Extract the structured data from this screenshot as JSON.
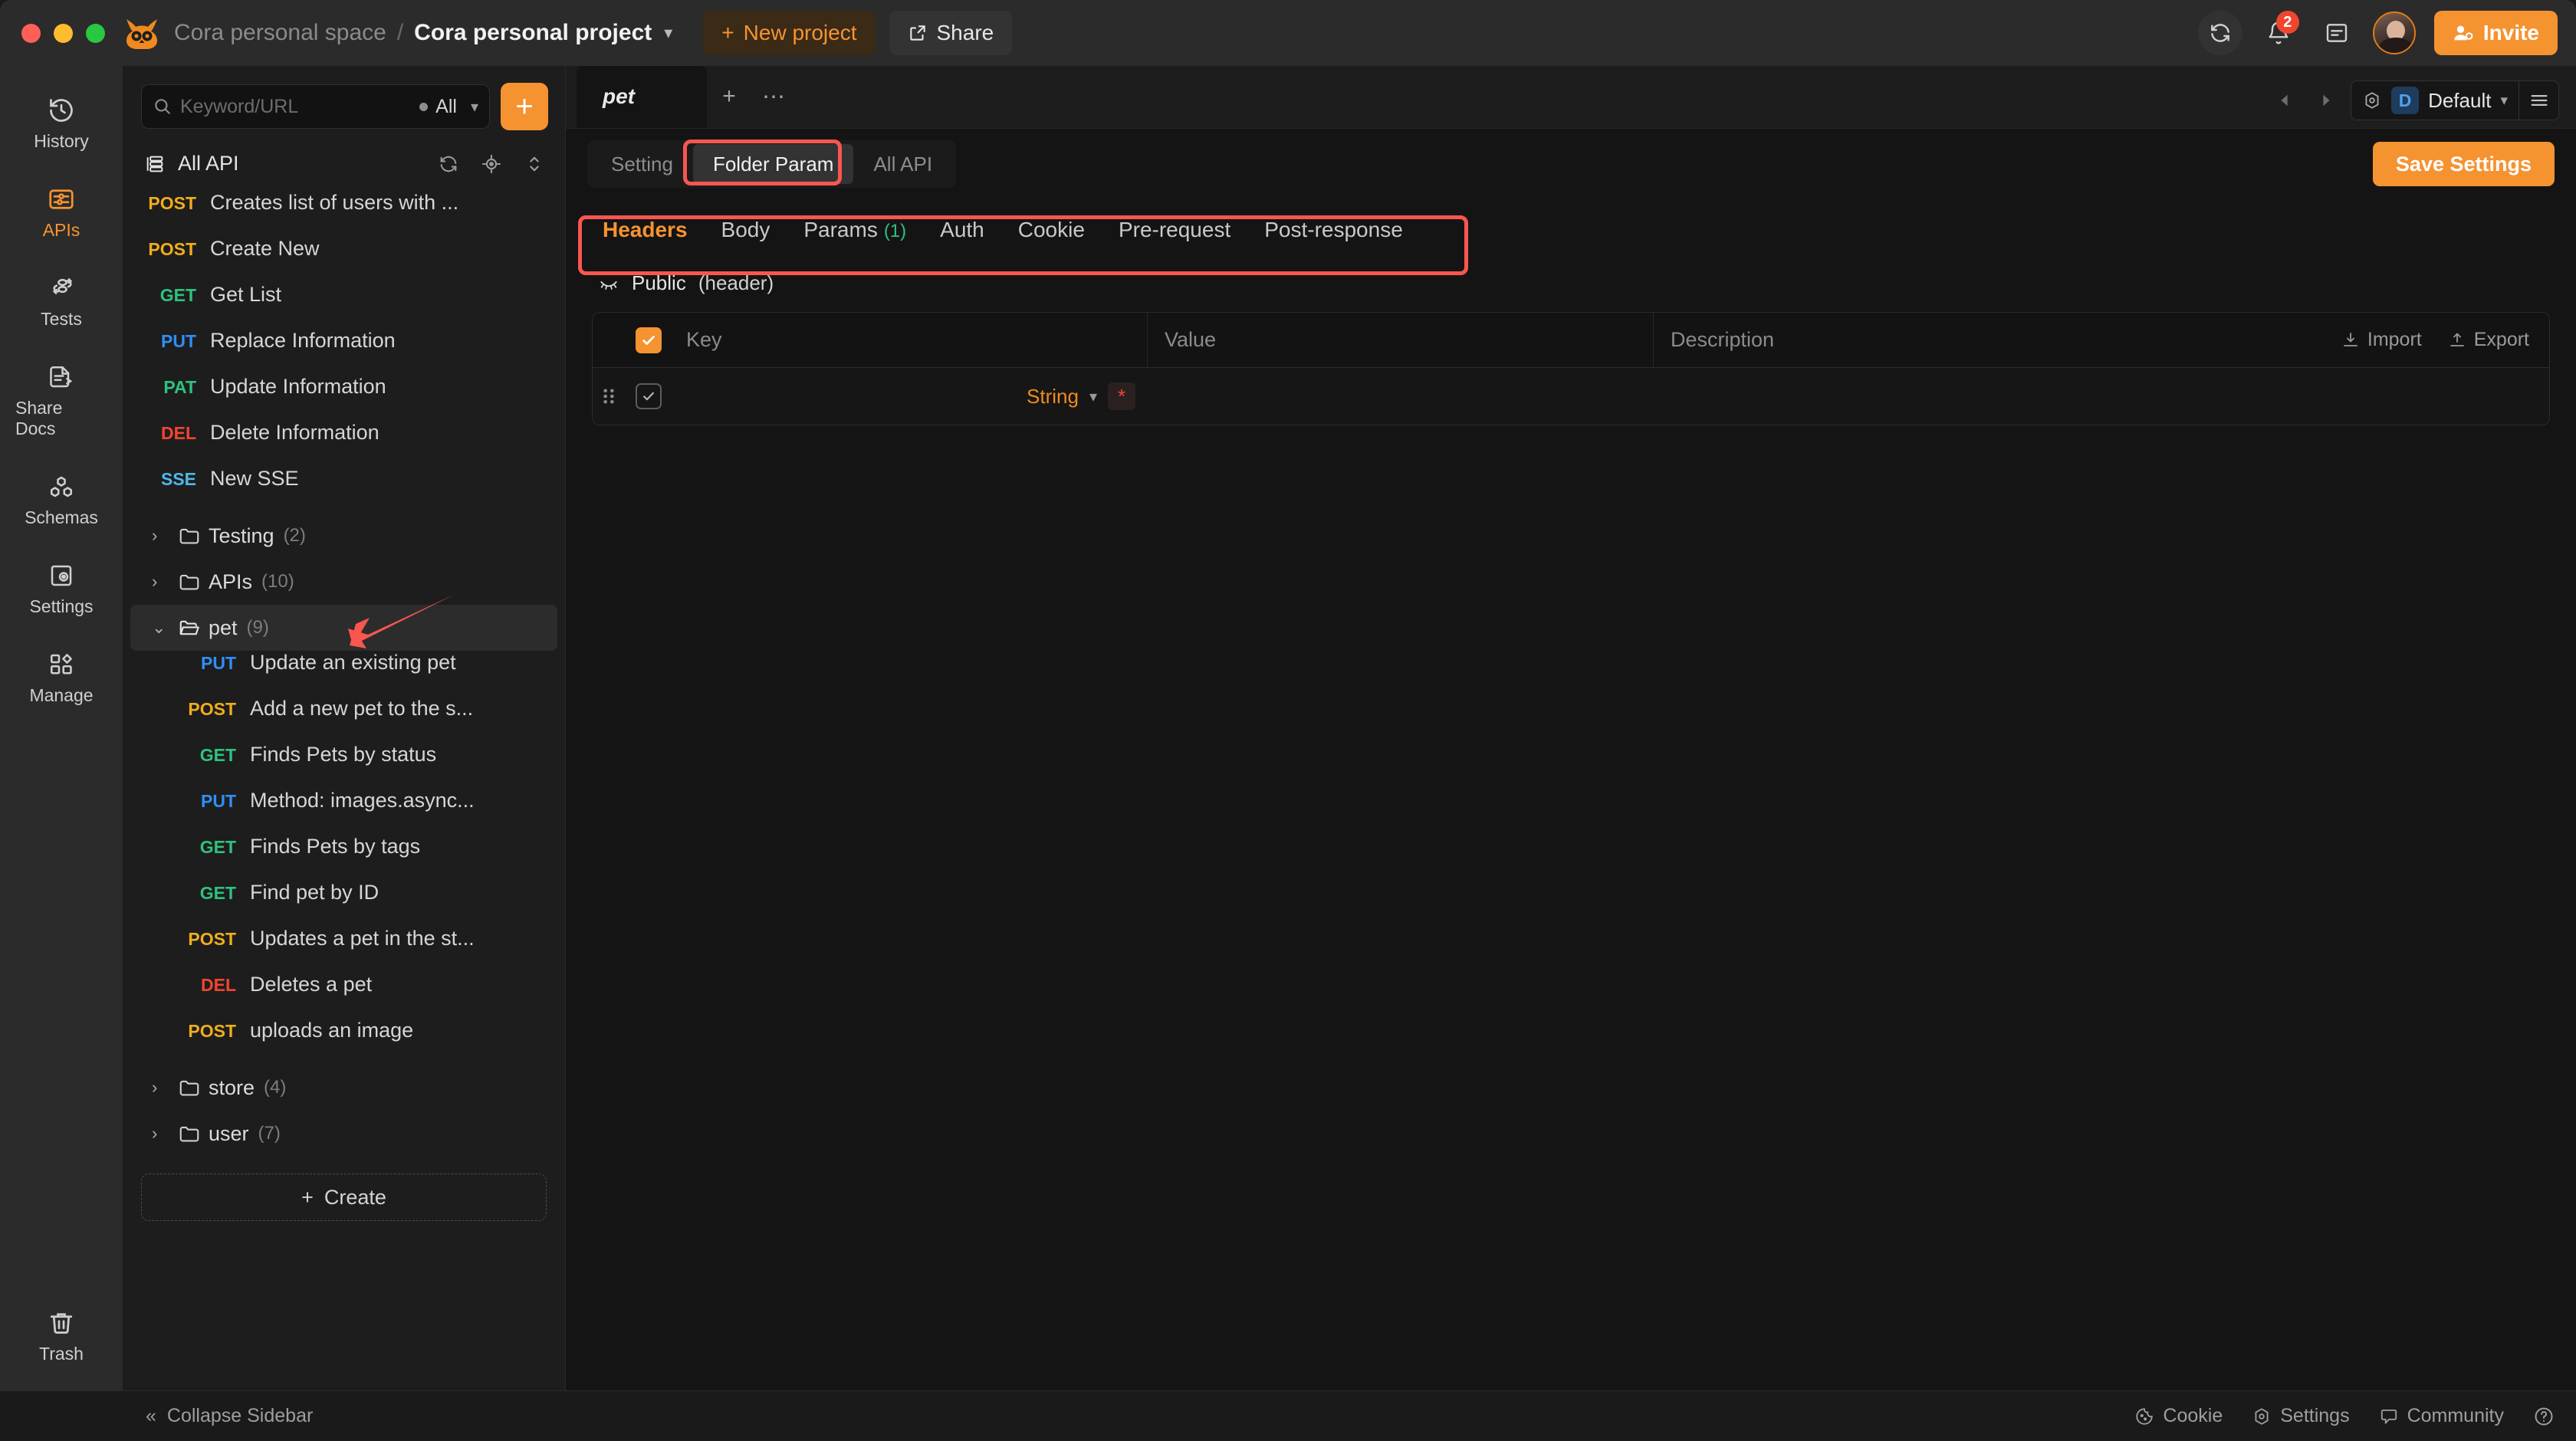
{
  "titlebar": {
    "space": "Cora personal space",
    "separator": "/",
    "project": "Cora personal project",
    "new_project": "New project",
    "share": "Share",
    "invite": "Invite",
    "notification_count": "2",
    "accent": "#f59331"
  },
  "rail": {
    "items": [
      {
        "label": "History",
        "icon": "history-icon",
        "active": false
      },
      {
        "label": "APIs",
        "icon": "apis-icon",
        "active": true
      },
      {
        "label": "Tests",
        "icon": "tests-icon",
        "active": false
      },
      {
        "label": "Share Docs",
        "icon": "share-docs-icon",
        "active": false
      },
      {
        "label": "Schemas",
        "icon": "schemas-icon",
        "active": false
      },
      {
        "label": "Settings",
        "icon": "settings-icon",
        "active": false
      },
      {
        "label": "Manage",
        "icon": "manage-icon",
        "active": false
      }
    ],
    "trash": "Trash"
  },
  "sidebar": {
    "search_placeholder": "Keyword/URL",
    "filter_label": "All",
    "all_api_label": "All API",
    "create_label": "Create",
    "root_apis": [
      {
        "method": "POST",
        "name": "Creates list of users with ..."
      },
      {
        "method": "POST",
        "name": "Create New"
      },
      {
        "method": "GET",
        "name": "Get List"
      },
      {
        "method": "PUT",
        "name": "Replace Information"
      },
      {
        "method": "PAT",
        "name": "Update Information"
      },
      {
        "method": "DEL",
        "name": "Delete Information"
      },
      {
        "method": "SSE",
        "name": "New SSE"
      }
    ],
    "folders_before": [
      {
        "name": "Testing",
        "count": "(2)",
        "expanded": false
      },
      {
        "name": "APIs",
        "count": "(10)",
        "expanded": false
      }
    ],
    "selected_folder": {
      "name": "pet",
      "count": "(9)",
      "expanded": true
    },
    "pet_apis": [
      {
        "method": "PUT",
        "name": "Update an existing pet"
      },
      {
        "method": "POST",
        "name": "Add a new pet to the s..."
      },
      {
        "method": "GET",
        "name": "Finds Pets by status"
      },
      {
        "method": "PUT",
        "name": "Method: images.async..."
      },
      {
        "method": "GET",
        "name": "Finds Pets by tags"
      },
      {
        "method": "GET",
        "name": "Find pet by ID"
      },
      {
        "method": "POST",
        "name": "Updates a pet in the st..."
      },
      {
        "method": "DEL",
        "name": "Deletes a pet"
      },
      {
        "method": "POST",
        "name": "uploads an image"
      }
    ],
    "folders_after": [
      {
        "name": "store",
        "count": "(4)",
        "expanded": false
      },
      {
        "name": "user",
        "count": "(7)",
        "expanded": false
      }
    ]
  },
  "main": {
    "doc_tab": "pet",
    "env": {
      "name": "Default",
      "chip": "D"
    },
    "section_tabs": [
      {
        "label": "Setting",
        "active": false
      },
      {
        "label": "Folder Param",
        "active": true
      },
      {
        "label": "All API",
        "active": false
      }
    ],
    "save_button": "Save Settings",
    "param_tabs": [
      {
        "label": "Headers",
        "count": "",
        "active": true
      },
      {
        "label": "Body",
        "count": "",
        "active": false
      },
      {
        "label": "Params",
        "count": "(1)",
        "active": false
      },
      {
        "label": "Auth",
        "count": "",
        "active": false
      },
      {
        "label": "Cookie",
        "count": "",
        "active": false
      },
      {
        "label": "Pre-request",
        "count": "",
        "active": false
      },
      {
        "label": "Post-response",
        "count": "",
        "active": false
      }
    ],
    "public_group": {
      "label": "Public",
      "sub": "(header)"
    },
    "table": {
      "columns": [
        "Key",
        "Value",
        "Description"
      ],
      "import_label": "Import",
      "export_label": "Export",
      "header_checkbox_checked": true,
      "rows": [
        {
          "checked": true,
          "key": "",
          "value": "",
          "description": "",
          "type": "String",
          "required": "*"
        }
      ]
    }
  },
  "footer": {
    "collapse_sidebar": "Collapse Sidebar",
    "items": [
      {
        "label": "Cookie",
        "icon": "cookie-icon"
      },
      {
        "label": "Settings",
        "icon": "settings-icon"
      },
      {
        "label": "Community",
        "icon": "community-icon"
      }
    ],
    "help_icon": "help-icon"
  }
}
